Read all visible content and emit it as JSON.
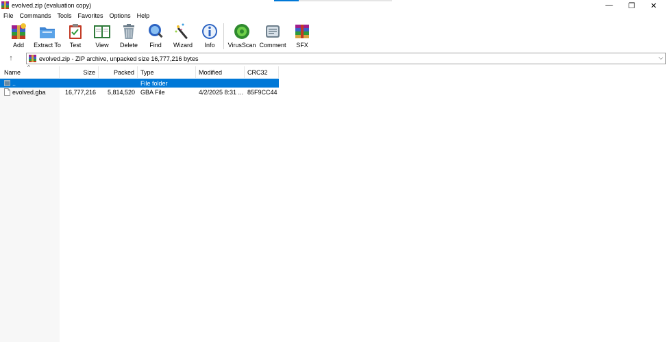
{
  "window": {
    "title": "evolved.zip (evaluation copy)",
    "minimize_glyph": "—",
    "maximize_glyph": "❐",
    "close_glyph": "✕"
  },
  "menu": [
    "File",
    "Commands",
    "Tools",
    "Favorites",
    "Options",
    "Help"
  ],
  "toolbar": {
    "add": "Add",
    "extract": "Extract To",
    "test": "Test",
    "view": "View",
    "delete": "Delete",
    "find": "Find",
    "wizard": "Wizard",
    "info": "Info",
    "virusscan": "VirusScan",
    "comment": "Comment",
    "sfx": "SFX"
  },
  "address": {
    "up_glyph": "↑",
    "text": "evolved.zip - ZIP archive, unpacked size 16,777,216 bytes",
    "dropdown_glyph": "⌵"
  },
  "columns": {
    "name": "Name",
    "size": "Size",
    "packed": "Packed",
    "type": "Type",
    "modified": "Modified",
    "crc": "CRC32",
    "sort_glyph": "^"
  },
  "rows": [
    {
      "name": "..",
      "size": "",
      "packed": "",
      "type": "File folder",
      "modified": "",
      "crc": ""
    },
    {
      "name": "evolved.gba",
      "size": "16,777,216",
      "packed": "5,814,520",
      "type": "GBA File",
      "modified": "4/2/2025 8:31 ...",
      "crc": "85F9CC44"
    }
  ],
  "colors": {
    "selection": "#0078d7",
    "title_accent": "#0078d7"
  }
}
